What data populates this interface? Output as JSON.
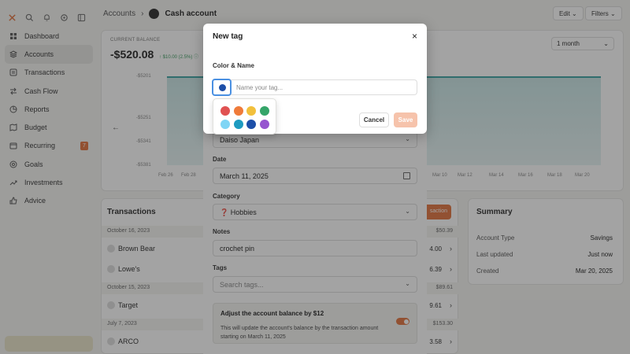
{
  "sidebar": {
    "items": [
      {
        "label": "Dashboard",
        "icon": "grid-icon",
        "active": false
      },
      {
        "label": "Accounts",
        "icon": "layers-icon",
        "active": true
      },
      {
        "label": "Transactions",
        "icon": "list-icon",
        "active": false
      },
      {
        "label": "Cash Flow",
        "icon": "flow-icon",
        "active": false
      },
      {
        "label": "Reports",
        "icon": "chart-icon",
        "active": false
      },
      {
        "label": "Budget",
        "icon": "map-icon",
        "active": false
      },
      {
        "label": "Recurring",
        "icon": "calendar-icon",
        "active": false,
        "badge": "7"
      },
      {
        "label": "Goals",
        "icon": "target-icon",
        "active": false
      },
      {
        "label": "Investments",
        "icon": "trend-icon",
        "active": false
      },
      {
        "label": "Advice",
        "icon": "thumb-icon",
        "active": false
      }
    ]
  },
  "header": {
    "breadcrumb_parent": "Accounts",
    "breadcrumb_sep": "›",
    "title": "Cash account",
    "edit_label": "Edit ⌄",
    "filters_label": "Filters ⌄"
  },
  "balance": {
    "label": "CURRENT BALANCE",
    "value": "-$520.08",
    "change": "↑ $10.00 (2.5%) ⓘ",
    "range": "1 month",
    "y_ticks": [
      "-$5201",
      "-$5251",
      "-$5341",
      "-$5381"
    ],
    "x_ticks": [
      "Feb 26",
      "Feb 28",
      "Mar 10",
      "Mar 12",
      "Mar 14",
      "Mar 16",
      "Mar 18",
      "Mar 20"
    ]
  },
  "transactions": {
    "title": "Transactions",
    "button": "saction",
    "groups": [
      {
        "date": "October 16, 2023",
        "amount": "$50.39",
        "rows": [
          {
            "name": "Brown Bear",
            "amount": "4.00"
          },
          {
            "name": "Lowe's",
            "amount": "6.39"
          }
        ]
      },
      {
        "date": "October 15, 2023",
        "amount": "$89.61",
        "rows": [
          {
            "name": "Target",
            "amount": "9.61"
          }
        ]
      },
      {
        "date": "July 7, 2023",
        "amount": "$153.30",
        "rows": [
          {
            "name": "ARCO",
            "amount": "3.58"
          }
        ]
      }
    ]
  },
  "summary": {
    "title": "Summary",
    "rows": [
      {
        "label": "Account Type",
        "value": "Savings"
      },
      {
        "label": "Last updated",
        "value": "Just now"
      },
      {
        "label": "Created",
        "value": "Mar 20, 2025"
      }
    ]
  },
  "edit": {
    "merchant": "Daiso Japan",
    "date_label": "Date",
    "date": "March 11, 2025",
    "category_label": "Category",
    "category": "❓ Hobbies",
    "notes_label": "Notes",
    "notes": "crochet pin",
    "tags_label": "Tags",
    "tags_placeholder": "Search tags...",
    "adjust_title": "Adjust the account balance by $12",
    "adjust_desc": "This will update the account's balance by the transaction amount starting on March 11, 2025"
  },
  "modal": {
    "title": "New tag",
    "close": "×",
    "section": "Color & Name",
    "selected_color": "#1d4fa8",
    "name_placeholder": "Name your tag...",
    "cancel": "Cancel",
    "save": "Save",
    "palette": [
      "#e05252",
      "#ef7b3a",
      "#f2c03c",
      "#35a569",
      "#7fd5f5",
      "#1e9bc0",
      "#1d4fa8",
      "#9655cf"
    ]
  },
  "colors": {
    "accent": "#e2733d",
    "chart_line": "#3aa3a3",
    "positive": "#3a9a5f"
  }
}
